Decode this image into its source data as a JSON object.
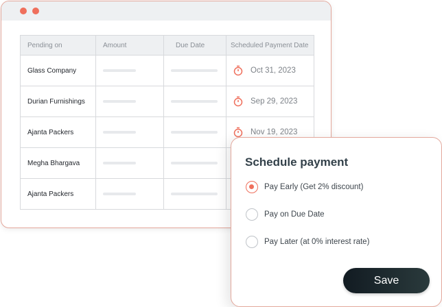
{
  "window": {
    "dots": [
      "#ef6f5c",
      "#ef6f5c"
    ]
  },
  "table": {
    "headers": [
      "Pending on",
      "Amount",
      "Due Date",
      "Scheduled Payment Date"
    ],
    "rows": [
      {
        "pending_on": "Glass Company",
        "scheduled_date": "Oct 31, 2023"
      },
      {
        "pending_on": "Durian Furnishings",
        "scheduled_date": "Sep 29, 2023"
      },
      {
        "pending_on": "Ajanta Packers",
        "scheduled_date": "Nov 19, 2023"
      },
      {
        "pending_on": "Megha Bhargava",
        "scheduled_date": ""
      },
      {
        "pending_on": "Ajanta Packers",
        "scheduled_date": ""
      }
    ]
  },
  "icons": {
    "scheduled": "stopwatch-icon"
  },
  "colors": {
    "accent": "#ef6f5c",
    "button": "#121b22"
  },
  "modal": {
    "title": "Schedule payment",
    "options": [
      {
        "label": "Pay Early (Get 2% discount)",
        "selected": true
      },
      {
        "label": "Pay on Due Date",
        "selected": false
      },
      {
        "label": "Pay Later (at 0% interest rate)",
        "selected": false
      }
    ],
    "save_label": "Save"
  }
}
